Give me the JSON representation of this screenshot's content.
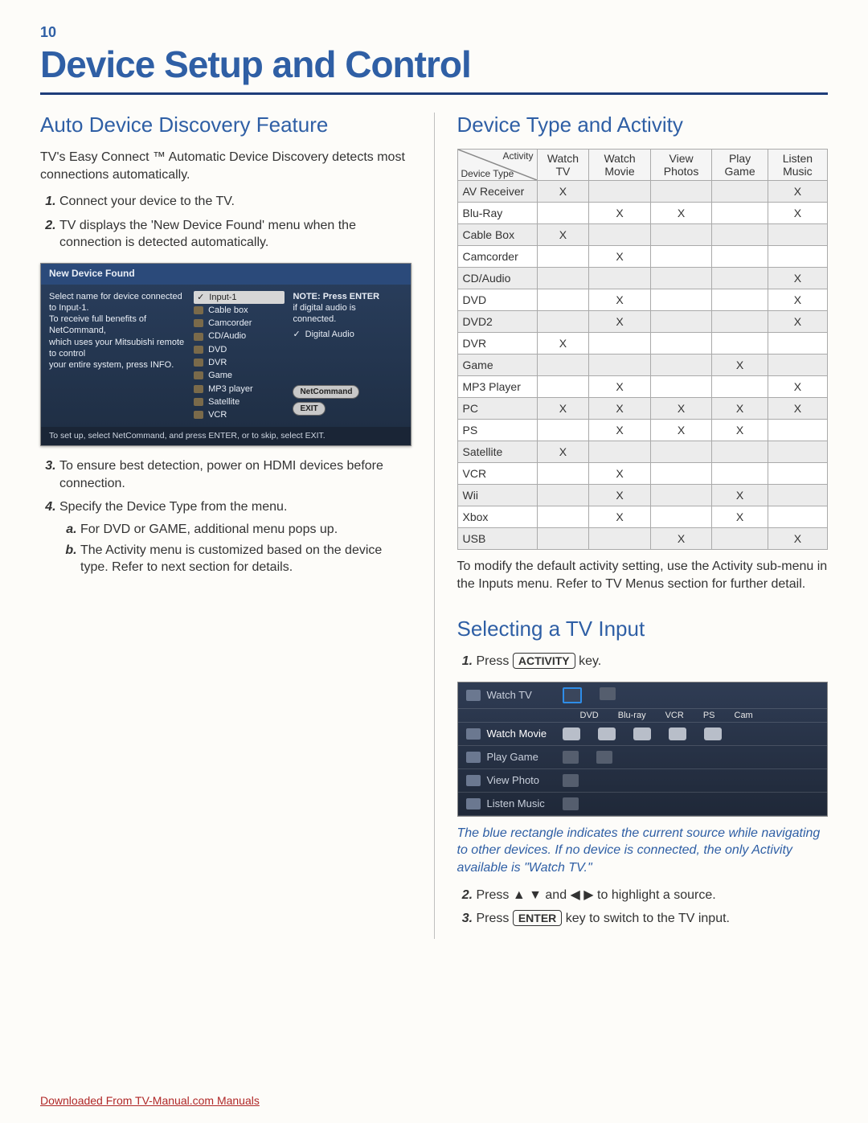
{
  "page_number": "10",
  "page_title": "Device Setup and Control",
  "left": {
    "h2": "Auto Device Discovery Feature",
    "intro": "TV's Easy Connect ™ Automatic Device Discovery detects most connections automatically.",
    "step1": "Connect your device to the TV.",
    "step2": "TV displays the 'New Device Found' menu when the connection is detected automatically.",
    "step3": "To ensure best detection, power on HDMI devices before connection.",
    "step4": "Specify the Device Type from the menu.",
    "step4a": "For DVD or GAME, additional menu pops up.",
    "step4b": "The Activity menu is customized based on the device type. Refer to next section for details."
  },
  "dialog": {
    "title": "New Device Found",
    "left_lines": [
      "Select name for device connected to Input-1.",
      "To receive full benefits of NetCommand,",
      "which uses your Mitsubishi remote to control",
      "your entire system, press INFO."
    ],
    "mid_items": [
      "Input-1",
      "Cable box",
      "Camcorder",
      "CD/Audio",
      "DVD",
      "DVR",
      "Game",
      "MP3 player",
      "Satellite",
      "VCR"
    ],
    "right_note_title": "NOTE: Press ENTER",
    "right_note_l2": "if digital audio is",
    "right_note_l3": "connected.",
    "chk": "Digital Audio",
    "btn_net": "NetCommand",
    "btn_exit": "EXIT",
    "footer": "To set up, select NetCommand, and press ENTER, or to skip, select EXIT."
  },
  "right": {
    "h2a": "Device Type and Activity",
    "table_note": "To modify the default activity setting, use the Activity sub-menu in the Inputs menu. Refer to TV Menus section for further detail.",
    "h2b": "Selecting a TV Input",
    "sel_step1_a": "Press ",
    "sel_step1_key": "ACTIVITY",
    "sel_step1_b": " key.",
    "blue_note": "The blue rectangle indicates the current source while navigating to other devices. If no device is connected, the only Activity available is \"Watch TV.\"",
    "sel_step2": "Press ▲ ▼ and ◀ ▶ to highlight a source.",
    "sel_step3_a": "Press ",
    "sel_step3_key": "ENTER",
    "sel_step3_b": " key to switch to the TV input."
  },
  "chart_data": {
    "type": "table",
    "corner_top": "Activity",
    "corner_bottom": "Device Type",
    "columns": [
      "Watch TV",
      "Watch Movie",
      "View Photos",
      "Play Game",
      "Listen Music"
    ],
    "rows": [
      {
        "label": "AV Receiver",
        "cells": [
          "X",
          "",
          "",
          "",
          "X"
        ]
      },
      {
        "label": "Blu-Ray",
        "cells": [
          "",
          "X",
          "X",
          "",
          "X"
        ]
      },
      {
        "label": "Cable Box",
        "cells": [
          "X",
          "",
          "",
          "",
          ""
        ]
      },
      {
        "label": "Camcorder",
        "cells": [
          "",
          "X",
          "",
          "",
          ""
        ]
      },
      {
        "label": "CD/Audio",
        "cells": [
          "",
          "",
          "",
          "",
          "X"
        ]
      },
      {
        "label": "DVD",
        "cells": [
          "",
          "X",
          "",
          "",
          "X"
        ]
      },
      {
        "label": "DVD2",
        "cells": [
          "",
          "X",
          "",
          "",
          "X"
        ]
      },
      {
        "label": "DVR",
        "cells": [
          "X",
          "",
          "",
          "",
          ""
        ]
      },
      {
        "label": "Game",
        "cells": [
          "",
          "",
          "",
          "X",
          ""
        ]
      },
      {
        "label": "MP3 Player",
        "cells": [
          "",
          "X",
          "",
          "",
          "X"
        ]
      },
      {
        "label": "PC",
        "cells": [
          "X",
          "X",
          "X",
          "X",
          "X"
        ]
      },
      {
        "label": "PS",
        "cells": [
          "",
          "X",
          "X",
          "X",
          ""
        ]
      },
      {
        "label": "Satellite",
        "cells": [
          "X",
          "",
          "",
          "",
          ""
        ]
      },
      {
        "label": "VCR",
        "cells": [
          "",
          "X",
          "",
          "",
          ""
        ]
      },
      {
        "label": "Wii",
        "cells": [
          "",
          "X",
          "",
          "X",
          ""
        ]
      },
      {
        "label": "Xbox",
        "cells": [
          "",
          "X",
          "",
          "X",
          ""
        ]
      },
      {
        "label": "USB",
        "cells": [
          "",
          "",
          "X",
          "",
          "X"
        ]
      }
    ]
  },
  "activity_ss": {
    "rows": [
      "Watch TV",
      "Watch Movie",
      "Play Game",
      "View Photo",
      "Listen Music"
    ],
    "dev_labels": [
      "DVD",
      "Blu-ray",
      "VCR",
      "PS",
      "Cam"
    ]
  },
  "footer_link": "Downloaded From TV-Manual.com Manuals"
}
